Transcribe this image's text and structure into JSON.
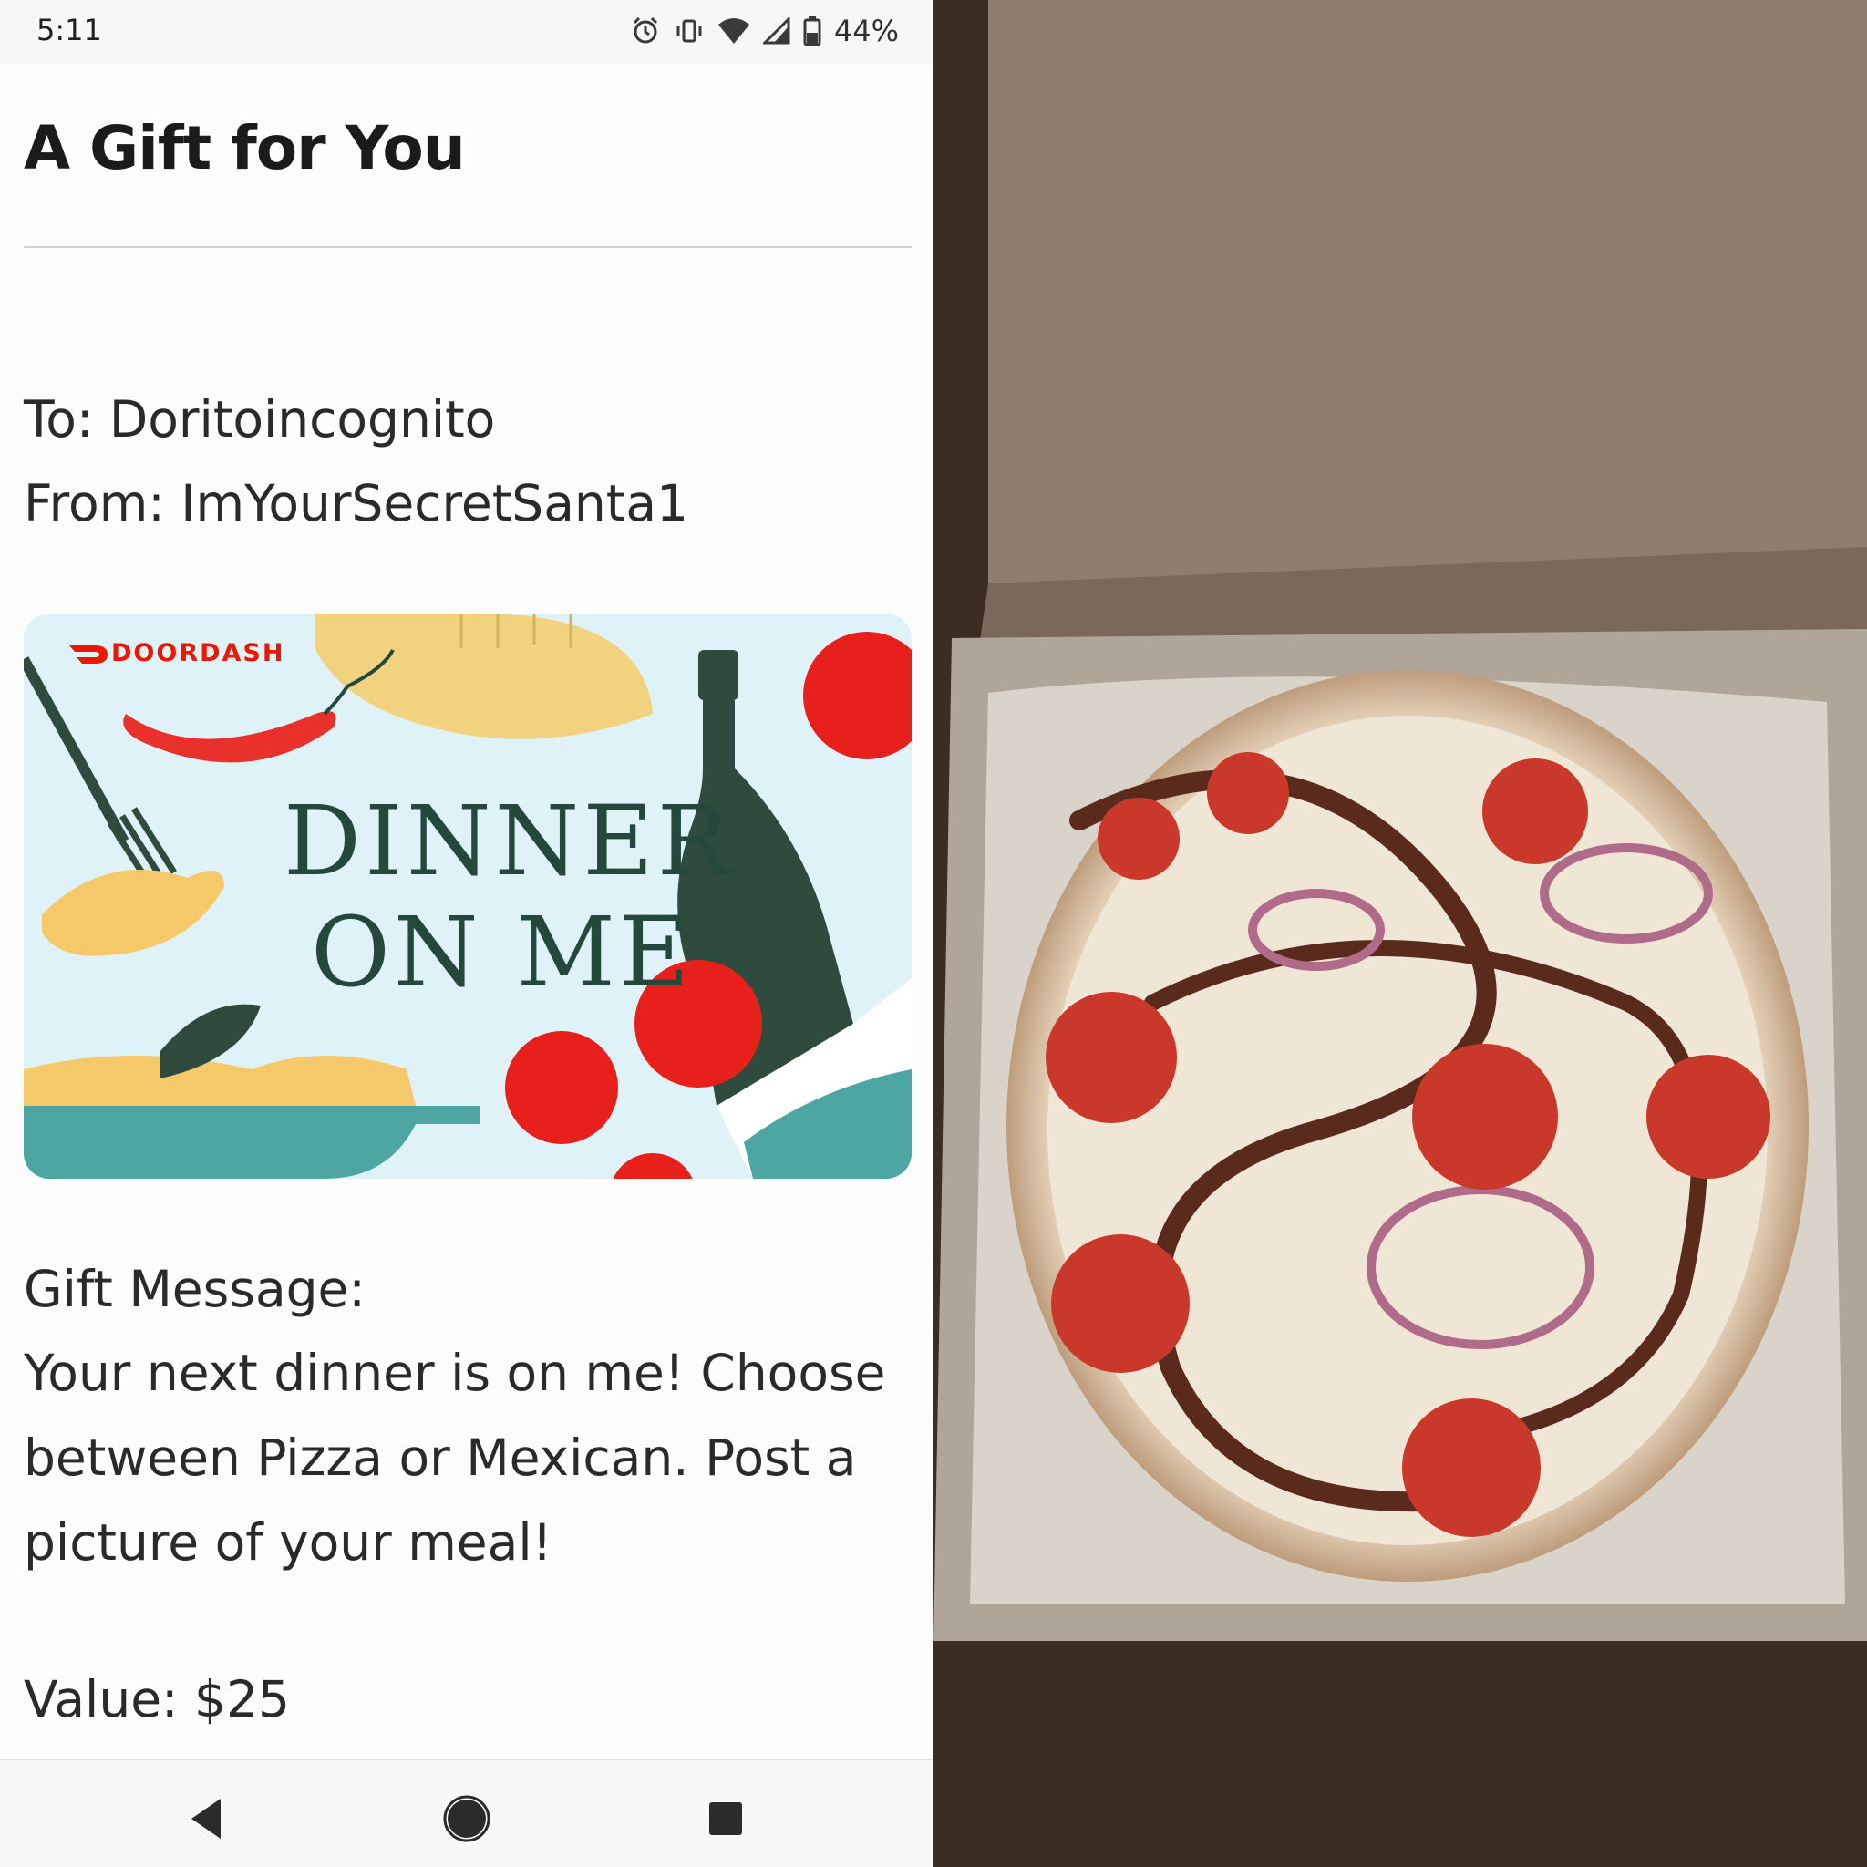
{
  "status_bar": {
    "time": "5:11",
    "battery": "44%",
    "icons": [
      "alarm-icon",
      "vibrate-icon",
      "wifi-icon",
      "signal-icon",
      "battery-icon"
    ]
  },
  "header": {
    "title": "A Gift for You"
  },
  "gift": {
    "to_line": "To: Doritoincognito",
    "from_line": "From: ImYourSecretSanta1",
    "card": {
      "brand": "DOORDASH",
      "headline_line1": "DINNER",
      "headline_line2": "ON ME"
    },
    "message_label": "Gift Message:",
    "message_lines": [
      "Your next dinner is on me! Choose",
      "between Pizza or Mexican. Post a",
      "picture of your meal!"
    ],
    "value_line": "Value: $25"
  },
  "nav_bar": {
    "buttons": [
      "back-icon",
      "home-icon",
      "recents-icon"
    ]
  },
  "colors": {
    "brand_red": "#eb1700",
    "card_background": "#dff2f8",
    "card_text": "#24483c"
  }
}
